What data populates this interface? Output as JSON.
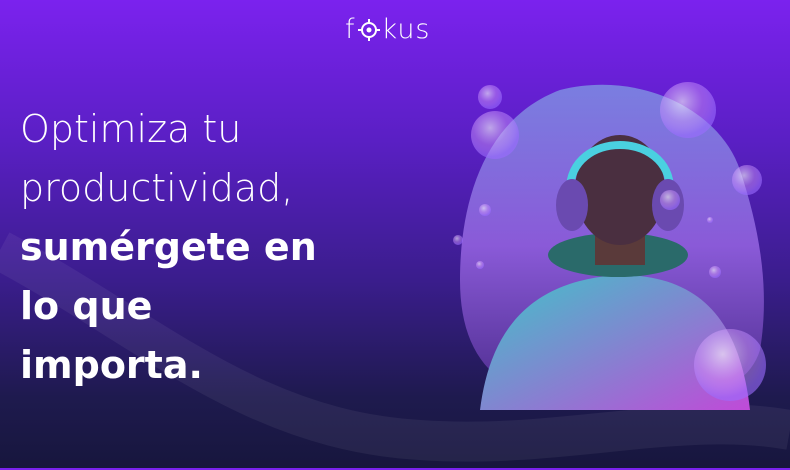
{
  "brand": {
    "logo_text_before": "f",
    "logo_text_after": "kus",
    "logo_full": "fokus"
  },
  "headline": {
    "line1": "Optimiza tu",
    "line2": "productividad,",
    "line3": "sumérgete en",
    "line4": "lo que",
    "line5": "importa."
  },
  "colors": {
    "bg_top": "#7b22ee",
    "bg_bottom": "#17163d",
    "accent": "#b57cff"
  }
}
